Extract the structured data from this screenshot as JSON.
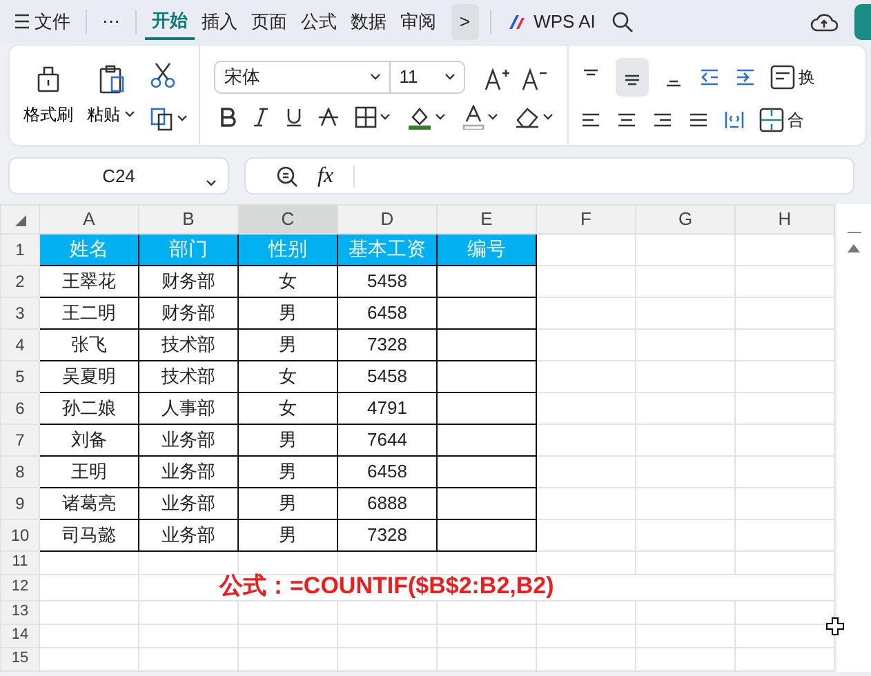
{
  "menu_bar": {
    "file_label": "文件",
    "more": "⋯",
    "tabs": [
      {
        "label": "开始",
        "selected": true
      },
      {
        "label": "插入",
        "selected": false
      },
      {
        "label": "页面",
        "selected": false
      },
      {
        "label": "公式",
        "selected": false
      },
      {
        "label": "数据",
        "selected": false
      },
      {
        "label": "审阅",
        "selected": false
      }
    ],
    "next_button": ">",
    "ai_label": "WPS AI"
  },
  "ribbon": {
    "format_painter": "格式刷",
    "paste": "粘贴",
    "font_name": "宋体",
    "font_size": "11",
    "wrap_label": "换",
    "merge_label": "合"
  },
  "formula_bar": {
    "name_box": "C24",
    "fx": "fx"
  },
  "columns": [
    {
      "letter": "A",
      "selected": false
    },
    {
      "letter": "B",
      "selected": false
    },
    {
      "letter": "C",
      "selected": true
    },
    {
      "letter": "D",
      "selected": false
    },
    {
      "letter": "E",
      "selected": false
    },
    {
      "letter": "F",
      "selected": false
    },
    {
      "letter": "G",
      "selected": false
    },
    {
      "letter": "H",
      "selected": false
    }
  ],
  "rows": [
    {
      "number": "1",
      "kind": "header",
      "cells": [
        "姓名",
        "部门",
        "性别",
        "基本工资",
        "编号"
      ]
    },
    {
      "number": "2",
      "kind": "data",
      "cells": [
        "王翠花",
        "财务部",
        "女",
        "5458",
        ""
      ]
    },
    {
      "number": "3",
      "kind": "data",
      "cells": [
        "王二明",
        "财务部",
        "男",
        "6458",
        ""
      ]
    },
    {
      "number": "4",
      "kind": "data",
      "cells": [
        "张飞",
        "技术部",
        "男",
        "7328",
        ""
      ]
    },
    {
      "number": "5",
      "kind": "data",
      "cells": [
        "吴夏明",
        "技术部",
        "女",
        "5458",
        ""
      ]
    },
    {
      "number": "6",
      "kind": "data",
      "cells": [
        "孙二娘",
        "人事部",
        "女",
        "4791",
        ""
      ]
    },
    {
      "number": "7",
      "kind": "data",
      "cells": [
        "刘备",
        "业务部",
        "男",
        "7644",
        ""
      ]
    },
    {
      "number": "8",
      "kind": "data",
      "cells": [
        "王明",
        "业务部",
        "男",
        "6458",
        ""
      ]
    },
    {
      "number": "9",
      "kind": "data",
      "cells": [
        "诸葛亮",
        "业务部",
        "男",
        "6888",
        ""
      ]
    },
    {
      "number": "10",
      "kind": "data",
      "cells": [
        "司马懿",
        "业务部",
        "男",
        "7328",
        ""
      ]
    },
    {
      "number": "11",
      "kind": "blank"
    },
    {
      "number": "12",
      "kind": "blank",
      "note": "公式：=COUNTIF($B$2:B2,B2)"
    },
    {
      "number": "13",
      "kind": "blank"
    },
    {
      "number": "14",
      "kind": "blank"
    },
    {
      "number": "15",
      "kind": "blank"
    }
  ]
}
